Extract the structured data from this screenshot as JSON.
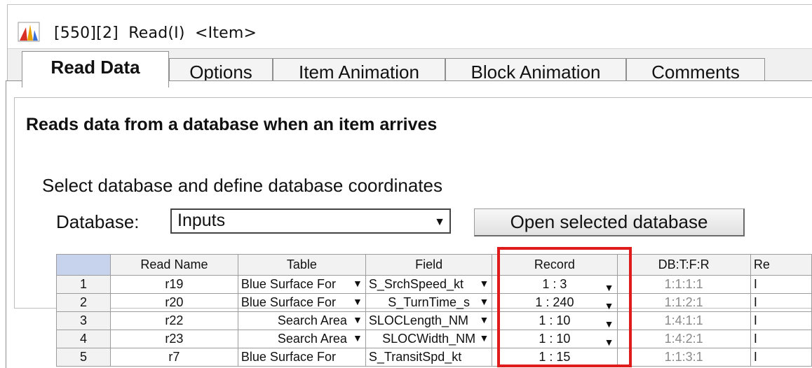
{
  "window": {
    "title": "[550][2]  Read(I)  <Item>"
  },
  "tabs": [
    {
      "label": "Read Data",
      "active": true
    },
    {
      "label": "Options",
      "active": false
    },
    {
      "label": "Item Animation",
      "active": false
    },
    {
      "label": "Block Animation",
      "active": false
    },
    {
      "label": "Comments",
      "active": false
    }
  ],
  "panel": {
    "description": "Reads data from a database when an item arrives",
    "group_title": "Select database and define database coordinates",
    "database_label": "Database:",
    "database_value": "Inputs",
    "open_button": "Open selected database"
  },
  "table": {
    "headers": [
      "Read Name",
      "Table",
      "Field",
      "Record",
      "DB:T:F:R",
      "Re"
    ],
    "rows": [
      {
        "num": "1",
        "name": "r19",
        "table": "Blue Surface For",
        "field": "S_SrchSpeed_kt",
        "record": "1 : 3",
        "dbtfr": "1:1:1:1",
        "re": "I"
      },
      {
        "num": "2",
        "name": "r20",
        "table": "Blue Surface For",
        "field": "S_TurnTime_s",
        "record": "1 : 240",
        "dbtfr": "1:1:2:1",
        "re": "I"
      },
      {
        "num": "3",
        "name": "r22",
        "table": "Search Area",
        "field": "SLOCLength_NM",
        "record": "1 : 10",
        "dbtfr": "1:4:1:1",
        "re": "I"
      },
      {
        "num": "4",
        "name": "r23",
        "table": "Search Area",
        "field": "SLOCWidth_NM",
        "record": "1 : 10",
        "dbtfr": "1:4:2:1",
        "re": "I"
      },
      {
        "num": "5",
        "name": "r7",
        "table": "Blue Surface For",
        "field": "S_TransitSpd_kt",
        "record": "1 : 15",
        "dbtfr": "1:1:3:1",
        "re": "I"
      }
    ]
  },
  "colors": {
    "highlight": "#e01b1b",
    "corner_header": "#c7d3ec"
  }
}
